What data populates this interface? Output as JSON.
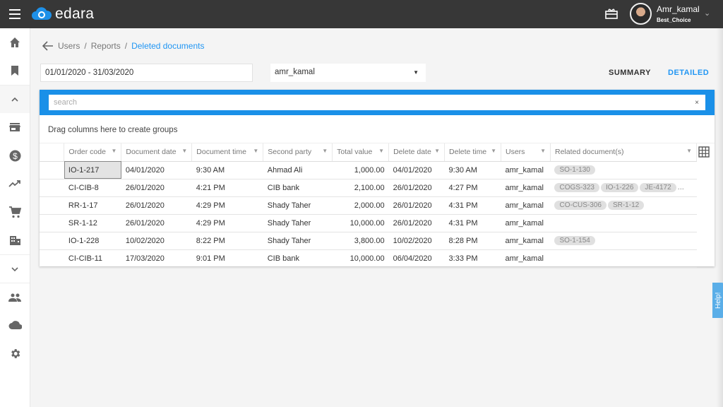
{
  "header": {
    "brand": "edara",
    "user_name": "Amr_kamal",
    "company": "Best_Choice"
  },
  "sidebar": {
    "items": [
      "home-icon",
      "bookmark-icon",
      "chevron-up-icon",
      "store-icon",
      "dollar-icon",
      "trending-up-icon",
      "cart-icon",
      "building-icon",
      "chevron-down-icon",
      "users-icon",
      "cloud-icon",
      "gear-icon"
    ]
  },
  "breadcrumb": {
    "items": [
      "Users",
      "Reports"
    ],
    "separator": "/",
    "current": "Deleted documents"
  },
  "filters": {
    "date_range": "01/01/2020 - 31/03/2020",
    "user": "amr_kamal"
  },
  "tabs": [
    {
      "label": "SUMMARY",
      "active": false
    },
    {
      "label": "DETAILED",
      "active": true
    }
  ],
  "search": {
    "placeholder": "search",
    "clear": "×"
  },
  "group_hint": "Drag columns here to create groups",
  "table": {
    "columns": [
      "Order code",
      "Document date",
      "Document time",
      "Second party",
      "Total value",
      "Delete date",
      "Delete time",
      "Users",
      "Related document(s)"
    ],
    "rows": [
      [
        "IO-1-217",
        "04/01/2020",
        "9:30 AM",
        "Ahmad Ali",
        "1,000.00",
        "04/01/2020",
        "9:30 AM",
        "amr_kamal",
        [
          "SO-1-130"
        ]
      ],
      [
        "CI-CIB-8",
        "26/01/2020",
        "4:21 PM",
        "CIB bank",
        "2,100.00",
        "26/01/2020",
        "4:27 PM",
        "amr_kamal",
        [
          "COGS-323",
          "IO-1-226",
          "JE-4172",
          "..."
        ]
      ],
      [
        "RR-1-17",
        "26/01/2020",
        "4:29 PM",
        "Shady Taher",
        "2,000.00",
        "26/01/2020",
        "4:31 PM",
        "amr_kamal",
        [
          "CO-CUS-306",
          "SR-1-12"
        ]
      ],
      [
        "SR-1-12",
        "26/01/2020",
        "4:29 PM",
        "Shady Taher",
        "10,000.00",
        "26/01/2020",
        "4:31 PM",
        "amr_kamal",
        []
      ],
      [
        "IO-1-228",
        "10/02/2020",
        "8:22 PM",
        "Shady Taher",
        "3,800.00",
        "10/02/2020",
        "8:28 PM",
        "amr_kamal",
        [
          "SO-1-154"
        ]
      ],
      [
        "CI-CIB-11",
        "17/03/2020",
        "9:01 PM",
        "CIB bank",
        "10,000.00",
        "06/04/2020",
        "3:33 PM",
        "amr_kamal",
        []
      ]
    ]
  },
  "help_label": "Help!",
  "colors": {
    "accent": "#1a90e8",
    "topbar": "#373737",
    "link": "#2196f3"
  }
}
